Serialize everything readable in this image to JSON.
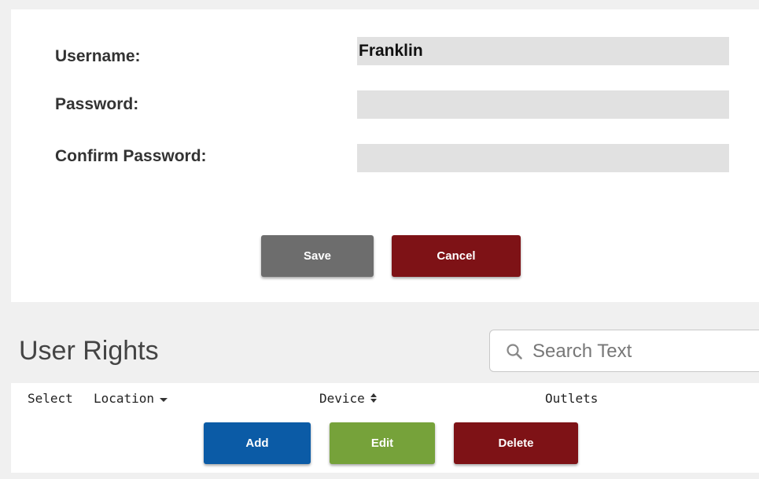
{
  "form": {
    "username_label": "Username:",
    "username_value": "Franklin",
    "password_label": "Password:",
    "password_value": "",
    "confirm_label": "Confirm Password:",
    "confirm_value": "",
    "save_label": "Save",
    "cancel_label": "Cancel"
  },
  "user_rights": {
    "title": "User Rights",
    "search_placeholder": "Search Text",
    "columns": [
      "Select",
      "Location",
      "Device",
      "Outlets"
    ],
    "add_label": "Add",
    "edit_label": "Edit",
    "delete_label": "Delete"
  },
  "colors": {
    "save": "#6d6d6d",
    "cancel": "#7e1216",
    "add": "#0b5ba6",
    "edit": "#76a23a",
    "delete": "#7e1216",
    "input_bg": "#e1e1e1"
  },
  "icons": {
    "search": "search-icon",
    "location_sort": "caret-down-icon",
    "device_sort": "sort-updown-icon"
  }
}
